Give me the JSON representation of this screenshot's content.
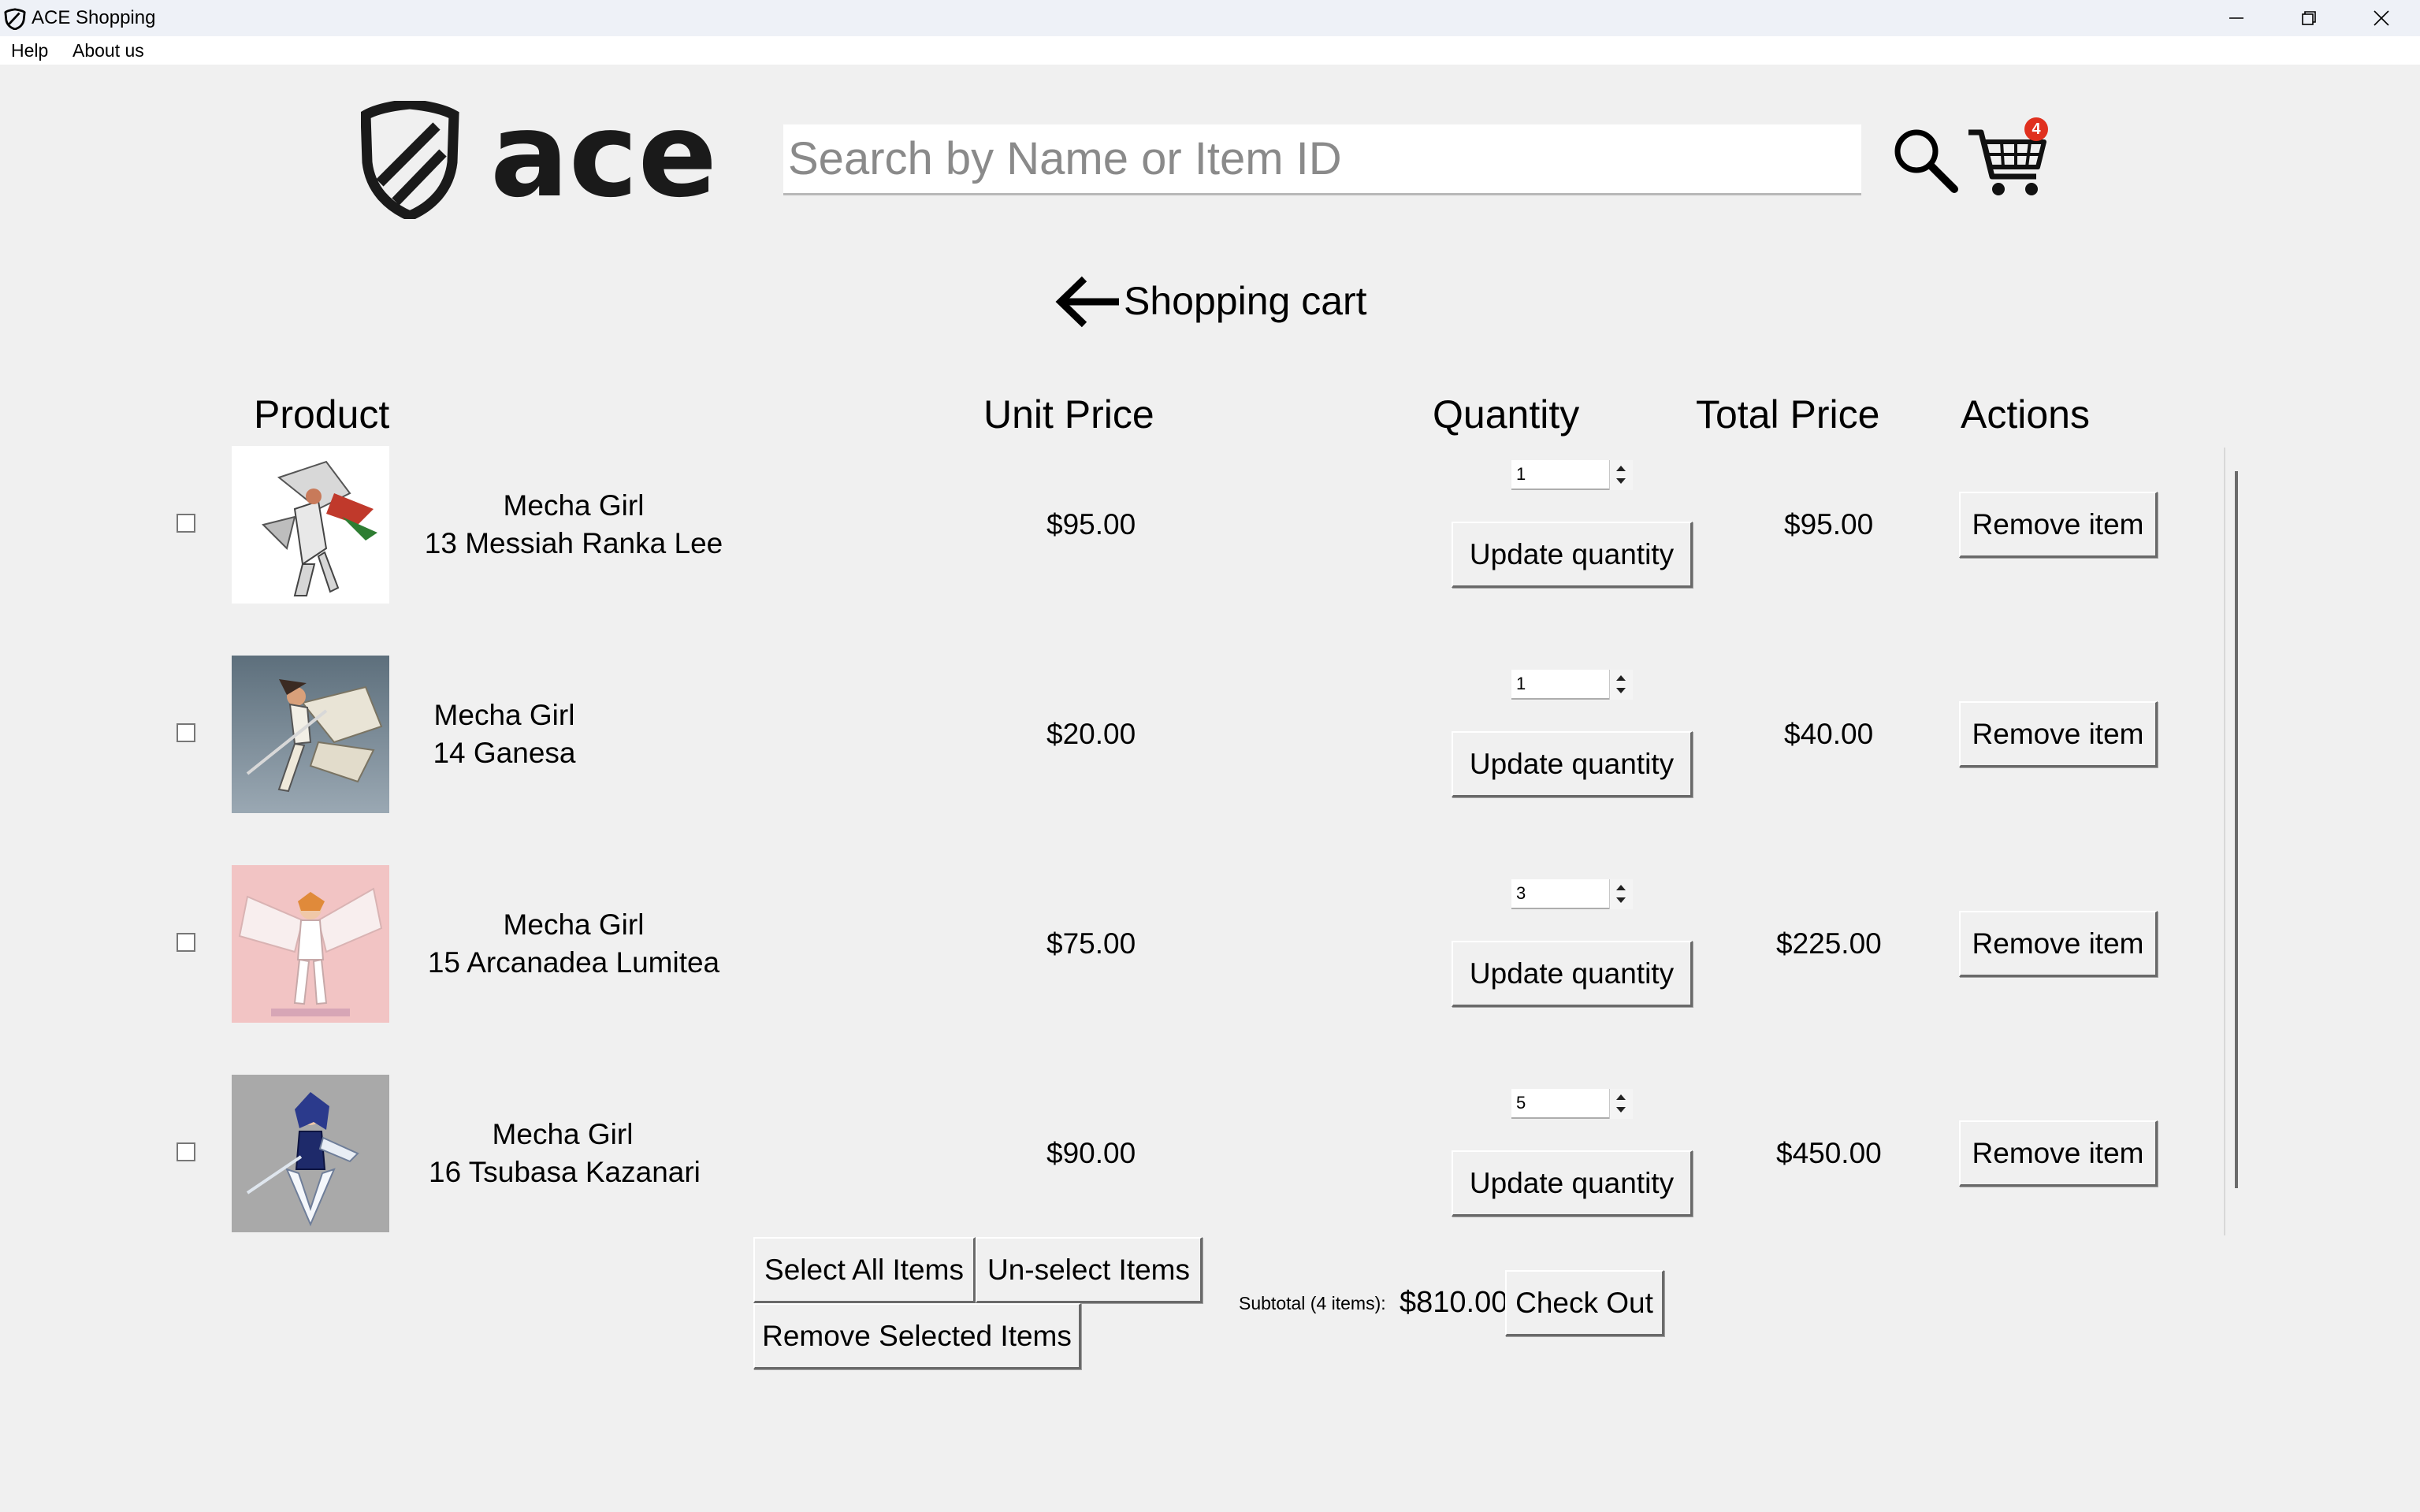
{
  "window": {
    "title": "ACE Shopping"
  },
  "menu": {
    "items": [
      "Help",
      "About us"
    ]
  },
  "header": {
    "logo_text": "ace",
    "search_placeholder": "Search by Name or Item ID",
    "cart_count": "4"
  },
  "page": {
    "title": "Shopping cart"
  },
  "table": {
    "headers": {
      "product": "Product",
      "unit_price": "Unit Price",
      "quantity": "Quantity",
      "total_price": "Total Price",
      "actions": "Actions"
    },
    "rows": [
      {
        "name": "Mecha Girl\n13 Messiah Ranka Lee",
        "unit_price": "$95.00",
        "quantity": "1",
        "total_price": "$95.00",
        "update_label": "Update quantity",
        "remove_label": "Remove item",
        "checked": false
      },
      {
        "name": "Mecha Girl\n14 Ganesa",
        "unit_price": "$20.00",
        "quantity": "1",
        "total_price": "$40.00",
        "update_label": "Update quantity",
        "remove_label": "Remove item",
        "checked": false
      },
      {
        "name": "Mecha Girl\n15 Arcanadea Lumitea",
        "unit_price": "$75.00",
        "quantity": "3",
        "total_price": "$225.00",
        "update_label": "Update quantity",
        "remove_label": "Remove item",
        "checked": false
      },
      {
        "name": "Mecha Girl\n16 Tsubasa Kazanari",
        "unit_price": "$90.00",
        "quantity": "5",
        "total_price": "$450.00",
        "update_label": "Update quantity",
        "remove_label": "Remove item",
        "checked": false
      }
    ]
  },
  "footer": {
    "select_all": "Select All Items",
    "unselect": "Un-select Items",
    "remove_selected": "Remove Selected Items",
    "subtotal_label": "Subtotal (4 items):",
    "subtotal_value": "$810.00",
    "checkout": "Check Out"
  },
  "colors": {
    "background": "#f0f0f0",
    "titlebar": "#eef1f7",
    "badge": "#e0301e"
  },
  "icons": [
    "app-shield-icon",
    "minimize-icon",
    "restore-icon",
    "close-icon",
    "search-icon",
    "cart-icon",
    "back-arrow-icon"
  ]
}
